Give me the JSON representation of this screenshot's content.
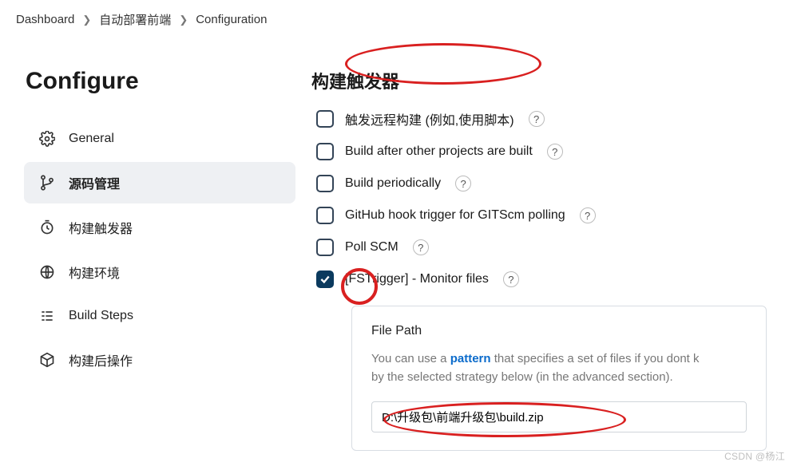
{
  "breadcrumb": {
    "a": "Dashboard",
    "b": "自动部署前端",
    "c": "Configuration"
  },
  "pageTitle": "Configure",
  "nav": {
    "general": "General",
    "scm": "源码管理",
    "triggers": "构建触发器",
    "env": "构建环境",
    "steps": "Build Steps",
    "post": "构建后操作"
  },
  "section": {
    "title": "构建触发器"
  },
  "opts": {
    "remote": "触发远程构建 (例如,使用脚本)",
    "after": "Build after other projects are built",
    "periodic": "Build periodically",
    "github": "GitHub hook trigger for GITScm polling",
    "poll": "Poll SCM",
    "fstrigger": "[FSTrigger] - Monitor files"
  },
  "subpanel": {
    "label": "File Path",
    "desc1": "You can use a ",
    "pattern": "pattern",
    "desc2": " that specifies a set of files if you dont k",
    "desc3": "by the selected strategy below (in the advanced section).",
    "value": "D:\\升级包\\前端升级包\\build.zip"
  },
  "watermark": "CSDN @杨江"
}
